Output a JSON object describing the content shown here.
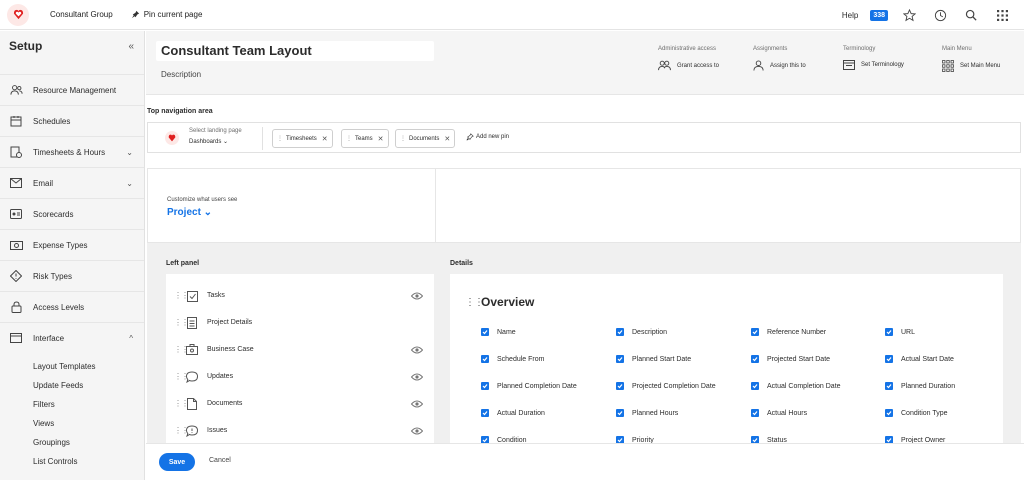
{
  "colors": {
    "accent": "#1473e6",
    "brand": "#e02020",
    "sidebar_bg": "#f5f5f5"
  },
  "topbar": {
    "org_name": "Consultant Group",
    "pin_label": "Pin current page",
    "help": "Help",
    "badge": "338",
    "icons": [
      "star-icon",
      "history-icon",
      "search-icon",
      "apps-grid-icon"
    ]
  },
  "sidebar": {
    "title": "Setup",
    "collapse_icon": "«",
    "items": [
      {
        "label": "Resource Management",
        "icon": "people-icon",
        "chevron": ""
      },
      {
        "label": "Schedules",
        "icon": "calendar-icon",
        "chevron": ""
      },
      {
        "label": "Timesheets & Hours",
        "icon": "timesheet-icon",
        "chevron": "⌄"
      },
      {
        "label": "Email",
        "icon": "email-icon",
        "chevron": "⌄"
      },
      {
        "label": "Scorecards",
        "icon": "scorecard-icon",
        "chevron": ""
      },
      {
        "label": "Expense Types",
        "icon": "expense-icon",
        "chevron": ""
      },
      {
        "label": "Risk Types",
        "icon": "risk-icon",
        "chevron": ""
      },
      {
        "label": "Access Levels",
        "icon": "lock-icon",
        "chevron": ""
      },
      {
        "label": "Interface",
        "icon": "interface-icon",
        "chevron": "^"
      }
    ],
    "subitems": [
      "Layout Templates",
      "Update Feeds",
      "Filters",
      "Views",
      "Groupings",
      "List Controls"
    ]
  },
  "header": {
    "title": "Consultant Team Layout",
    "description": "Description",
    "groups": [
      {
        "caption": "Administrative access",
        "action": "Grant access to",
        "icon": "group-icon"
      },
      {
        "caption": "Assignments",
        "action": "Assign this to",
        "icon": "user-icon"
      },
      {
        "caption": "Terminology",
        "action": "Set Terminology",
        "icon": "terminology-icon"
      },
      {
        "caption": "Main Menu",
        "action": "Set Main Menu",
        "icon": "menu-grid-icon"
      }
    ]
  },
  "nav": {
    "label": "Top navigation area",
    "landing_caption": "Select landing page",
    "landing_value": "Dashboards ⌄",
    "pins": [
      "Timesheets",
      "Teams",
      "Documents"
    ],
    "add_pin": "Add new pin"
  },
  "customize": {
    "caption": "Customize what users see",
    "value": "Project ⌄"
  },
  "left_panel": {
    "label": "Left panel",
    "items": [
      {
        "label": "Tasks",
        "icon": "task-icon",
        "eye": true
      },
      {
        "label": "Project Details",
        "icon": "details-icon",
        "eye": false
      },
      {
        "label": "Business Case",
        "icon": "business-case-icon",
        "eye": true
      },
      {
        "label": "Updates",
        "icon": "updates-icon",
        "eye": true
      },
      {
        "label": "Documents",
        "icon": "document-icon",
        "eye": true
      },
      {
        "label": "Issues",
        "icon": "issues-icon",
        "eye": true
      }
    ]
  },
  "details": {
    "label": "Details",
    "section_title": "Overview",
    "fields": [
      [
        "Name",
        "Description",
        "Reference Number",
        "URL"
      ],
      [
        "Schedule From",
        "Planned Start Date",
        "Projected Start Date",
        "Actual Start Date"
      ],
      [
        "Planned Completion Date",
        "Projected Completion Date",
        "Actual Completion Date",
        "Planned Duration"
      ],
      [
        "Actual Duration",
        "Planned Hours",
        "Actual Hours",
        "Condition Type"
      ],
      [
        "Condition",
        "Priority",
        "Status",
        "Project Owner"
      ]
    ]
  },
  "footer": {
    "save": "Save",
    "cancel": "Cancel"
  }
}
